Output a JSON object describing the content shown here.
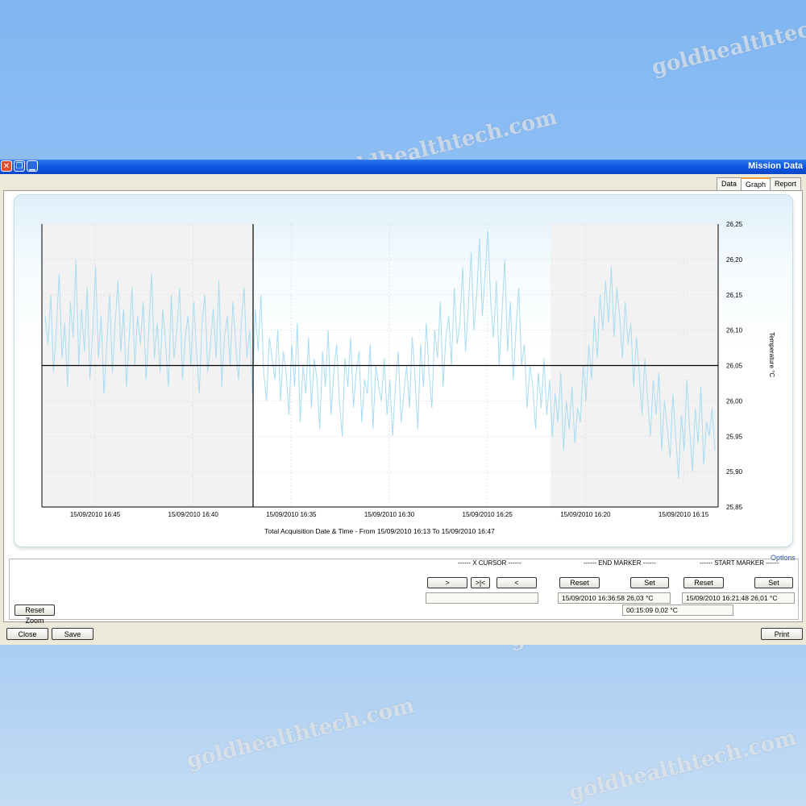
{
  "window": {
    "title": "Mission Data"
  },
  "tabs": [
    "Report",
    "Graph",
    "Data"
  ],
  "active_tab": "Graph",
  "colors": {
    "titlebar": "#0d55e0",
    "series": "#a8dcf0",
    "shade": "#f2f2f2"
  },
  "icons": [
    "close-icon",
    "restore-icon",
    "minimize-icon"
  ],
  "chart_data": {
    "type": "line",
    "series": [
      {
        "values": [
          26.12,
          26.08,
          26.15,
          26.04,
          26.1,
          26.18,
          26.06,
          26.11,
          26.02,
          26.14,
          26.09,
          26.2,
          26.05,
          26.13,
          26.07,
          26.16,
          26.03,
          26.1,
          26.19,
          26.06,
          26.12,
          26.01,
          26.08,
          26.15,
          26.04,
          26.11,
          26.17,
          26.07,
          26.13,
          26.02,
          26.09,
          26.16,
          26.05,
          26.12,
          26.08,
          26.14,
          26.03,
          26.1,
          26.18,
          26.06,
          26.11,
          26.04,
          26.13,
          26.08,
          26.02,
          26.15,
          26.06,
          26.1,
          26.16,
          26.03,
          26.09,
          26.12,
          26.05,
          26.14,
          26.07,
          26.01,
          26.11,
          26.15,
          26.04,
          26.08,
          26.13,
          26.06,
          26.17,
          26.02,
          26.09,
          26.12,
          26.05,
          26.14,
          26.08,
          26.03,
          26.11,
          26.16,
          26.06,
          26.1,
          26.01,
          26.13,
          26.07,
          26.15,
          26.04,
          26.0,
          26.09,
          26.06,
          26.03,
          26.1,
          26.0,
          26.07,
          26.04,
          25.98,
          26.08,
          26.02,
          26.11,
          25.97,
          26.05,
          26.01,
          26.09,
          25.99,
          26.06,
          26.03,
          25.96,
          26.07,
          26.02,
          26.1,
          25.98,
          26.04,
          26.08,
          26.0,
          25.95,
          26.06,
          26.02,
          26.09,
          25.99,
          26.04,
          26.07,
          25.97,
          26.03,
          26.01,
          26.08,
          25.96,
          26.05,
          26.02,
          26.0,
          26.06,
          25.98,
          26.03,
          25.95,
          26.02,
          26.07,
          25.97,
          26.01,
          26.05,
          25.99,
          26.09,
          26.03,
          25.96,
          26.08,
          26.02,
          26.11,
          26.04,
          25.99,
          26.1,
          26.06,
          26.14,
          26.02,
          26.09,
          26.12,
          26.05,
          26.16,
          26.08,
          26.11,
          26.19,
          26.07,
          26.13,
          26.21,
          26.1,
          26.15,
          26.23,
          26.12,
          26.18,
          26.24,
          26.14,
          26.09,
          26.17,
          26.05,
          26.12,
          26.2,
          26.07,
          26.14,
          26.03,
          26.1,
          26.16,
          26.05,
          26.08,
          25.99,
          26.05,
          26.02,
          25.96,
          26.04,
          25.99,
          26.06,
          25.98,
          26.03,
          25.95,
          26.01,
          25.97,
          26.04,
          25.93,
          26.0,
          25.96,
          26.02,
          25.94,
          25.99,
          25.97,
          26.05,
          26.0,
          26.08,
          26.03,
          26.12,
          26.06,
          26.15,
          26.1,
          26.17,
          26.11,
          26.19,
          26.09,
          26.16,
          26.12,
          26.06,
          26.14,
          26.08,
          26.11,
          26.02,
          26.09,
          26.04,
          25.98,
          26.06,
          26.0,
          25.95,
          26.03,
          25.98,
          26.04,
          25.93,
          26.0,
          25.96,
          25.92,
          26.01,
          25.95,
          25.89,
          25.98,
          25.93,
          26.03,
          25.96,
          25.9,
          25.99,
          25.94,
          26.02,
          25.91,
          25.97,
          25.95,
          25.99,
          25.93
        ]
      }
    ],
    "x_ticks": [
      "15/09/2010 16:15",
      "15/09/2010 16:20",
      "15/09/2010 16:25",
      "15/09/2010 16:30",
      "15/09/2010 16:35",
      "15/09/2010 16:40",
      "15/09/2010 16:45"
    ],
    "y_ticks": [
      "26,25",
      "26,20",
      "26,15",
      "26,10",
      "26,05",
      "26,00",
      "25,95",
      "25,90",
      "25,85"
    ],
    "ylim": [
      25.85,
      26.25
    ],
    "ylabel": "Temperature °C",
    "xlabel": "Total Acquisition Date & Time - From 15/09/2010 16:13 To 15/09/2010 16:47",
    "cursor_y": 26.05
  },
  "options": {
    "link": "Options",
    "start_marker": {
      "title": "------ START MARKER ------",
      "set": "Set",
      "reset": "Reset",
      "value": "15/09/2010 16:21:48 26,01 °C"
    },
    "end_marker": {
      "title": "------ END MARKER ------",
      "set": "Set",
      "reset": "Reset",
      "value": "15/09/2010 16:36:58 26,03 °C"
    },
    "x_cursor": {
      "title": "------ X CURSOR ------",
      "prev": "<",
      "center": ">|<",
      "next": ">",
      "value": ""
    },
    "duration": "00:15:09 0,02 °C",
    "reset_zoom": "Reset Zoom"
  },
  "footer": {
    "print": "Print",
    "save": "Save",
    "close": "Close"
  },
  "watermark": "goldhealthtech.com"
}
